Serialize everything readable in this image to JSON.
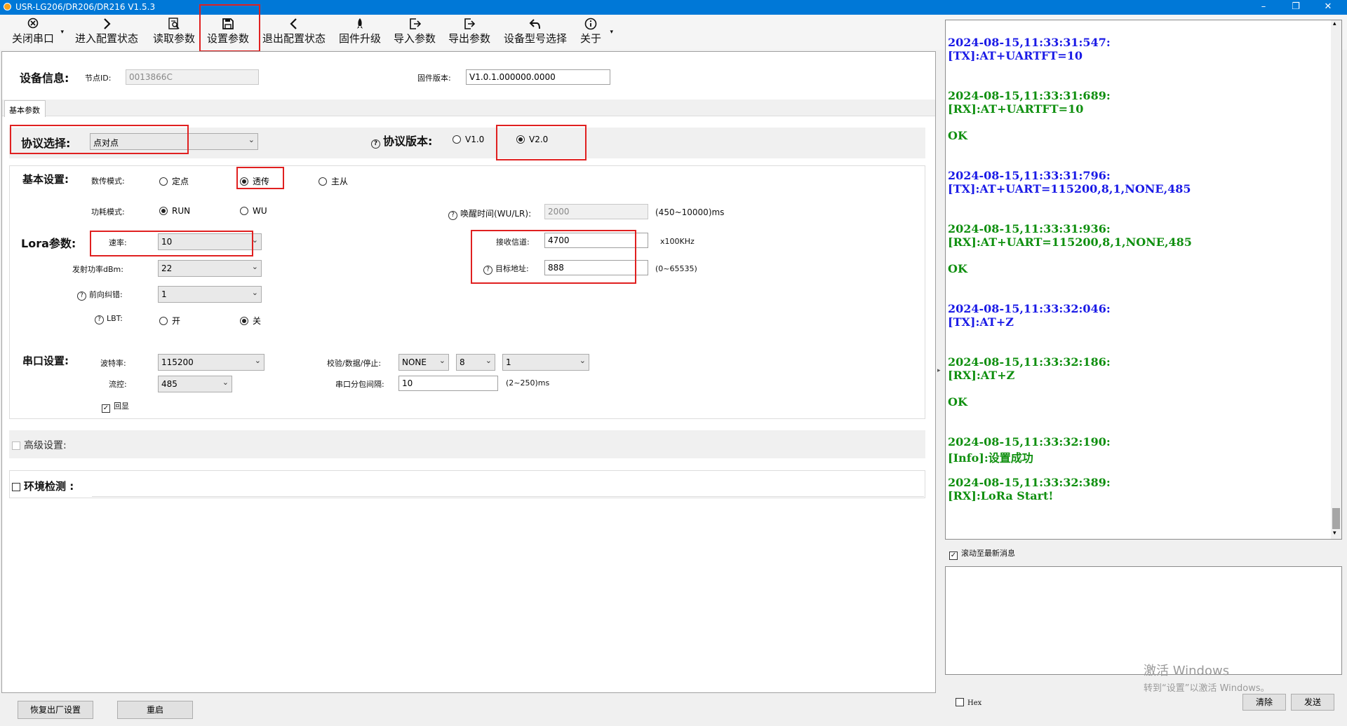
{
  "window": {
    "title": "USR-LG206/DR206/DR216 V1.5.3",
    "minimize": "–",
    "maximize": "❐",
    "close": "✕"
  },
  "toolbar": {
    "close_port": "关闭串口",
    "enter_config": "进入配置状态",
    "read_params": "读取参数",
    "set_params": "设置参数",
    "exit_config": "退出配置状态",
    "firmware_upgrade": "固件升级",
    "import_params": "导入参数",
    "export_params": "导出参数",
    "device_model": "设备型号选择",
    "about": "关于"
  },
  "device_info": {
    "header": "设备信息:",
    "node_id_label": "节点ID:",
    "node_id_value": "0013866C",
    "firmware_label": "固件版本:",
    "firmware_value": "V1.0.1.000000.0000"
  },
  "tab": {
    "basic": "基本参数"
  },
  "protocol": {
    "label": "协议选择:",
    "value": "点对点",
    "version_label": "协议版本:",
    "v1": "V1.0",
    "v2": "V2.0",
    "selected": "V2.0"
  },
  "basic": {
    "header": "基本设置:",
    "transmit_mode_label": "数传模式:",
    "mode_fixed": "定点",
    "mode_transparent": "透传",
    "mode_master_slave": "主从",
    "power_mode_label": "功耗模式:",
    "power_run": "RUN",
    "power_wu": "WU",
    "wake_time_label": "唤醒时间(WU/LR):",
    "wake_time_value": "2000",
    "wake_time_range": "(450~10000)ms"
  },
  "lora": {
    "header": "Lora参数:",
    "rate_label": "速率:",
    "rate_value": "10",
    "tx_power_label": "发射功率dBm:",
    "tx_power_value": "22",
    "fec_label": "前向纠错:",
    "fec_value": "1",
    "lbt_label": "LBT:",
    "lbt_on": "开",
    "lbt_off": "关",
    "rx_channel_label": "接收信道:",
    "rx_channel_value": "4700",
    "rx_channel_unit": "x100KHz",
    "target_addr_label": "目标地址:",
    "target_addr_value": "888",
    "target_addr_range": "(0~65535)"
  },
  "serial": {
    "header": "串口设置:",
    "baud_label": "波特率:",
    "baud_value": "115200",
    "flow_label": "流控:",
    "flow_value": "485",
    "echo_label": "回显",
    "parity_label": "校验/数据/停止:",
    "parity_value": "NONE",
    "data_bits_value": "8",
    "stop_bits_value": "1",
    "packet_interval_label": "串口分包间隔:",
    "packet_interval_value": "10",
    "packet_interval_range": "(2~250)ms"
  },
  "advanced": {
    "label": "高级设置:"
  },
  "env": {
    "label": "环境检测 :"
  },
  "bottom": {
    "factory_reset": "恢复出厂设置",
    "restart": "重启"
  },
  "log": {
    "lines": [
      {
        "text": "2024-08-15,11:33:31:547:",
        "color": "#1a1ae6"
      },
      {
        "text": "[TX]:AT+UARTFT=10",
        "color": "#1a1ae6"
      },
      {
        "text": "2024-08-15,11:33:31:689:",
        "color": "#0f8f0f"
      },
      {
        "text": "[RX]:AT+UARTFT=10",
        "color": "#0f8f0f"
      },
      {
        "text": "OK",
        "color": "#0f8f0f"
      },
      {
        "text": "2024-08-15,11:33:31:796:",
        "color": "#1a1ae6"
      },
      {
        "text": "[TX]:AT+UART=115200,8,1,NONE,485",
        "color": "#1a1ae6"
      },
      {
        "text": "2024-08-15,11:33:31:936:",
        "color": "#0f8f0f"
      },
      {
        "text": "[RX]:AT+UART=115200,8,1,NONE,485",
        "color": "#0f8f0f"
      },
      {
        "text": "OK",
        "color": "#0f8f0f"
      },
      {
        "text": "2024-08-15,11:33:32:046:",
        "color": "#1a1ae6"
      },
      {
        "text": "[TX]:AT+Z",
        "color": "#1a1ae6"
      },
      {
        "text": "2024-08-15,11:33:32:186:",
        "color": "#0f8f0f"
      },
      {
        "text": "[RX]:AT+Z",
        "color": "#0f8f0f"
      },
      {
        "text": "OK",
        "color": "#0f8f0f"
      },
      {
        "text": "2024-08-15,11:33:32:190:",
        "color": "#0f8f0f"
      },
      {
        "text": "[Info]:设置成功",
        "color": "#0f8f0f"
      },
      {
        "text": "2024-08-15,11:33:32:389:",
        "color": "#0f8f0f"
      },
      {
        "text": "[RX]:LoRa Start!",
        "color": "#0f8f0f"
      }
    ],
    "autoscroll_label": "滚动至最新消息",
    "hex_label": "Hex",
    "clear": "清除",
    "send": "发送"
  },
  "watermark": {
    "line1": "激活 Windows",
    "line2": "转到“设置”以激活 Windows。"
  }
}
